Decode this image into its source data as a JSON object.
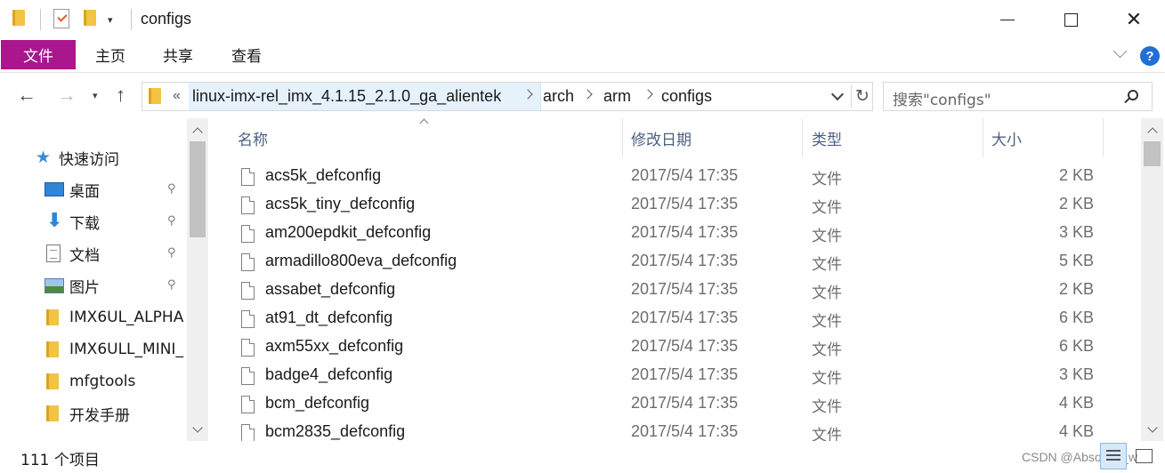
{
  "window": {
    "title": "configs",
    "minimize_icon": "minimize-icon",
    "maximize_icon": "maximize-icon",
    "close_glyph": "✕"
  },
  "quick_access_toolbar": {
    "dropdown_glyph": "▾"
  },
  "ribbon": {
    "tabs": [
      "文件",
      "主页",
      "共享",
      "查看"
    ],
    "file_tab_color": "#a9168d",
    "help_label": "?"
  },
  "navigation": {
    "back_glyph": "←",
    "forward_glyph": "→",
    "recent_glyph": "▾",
    "up_glyph": "↑"
  },
  "address": {
    "overflow": "«",
    "crumbs": [
      "linux-imx-rel_imx_4.1.15_2.1.0_ga_alientek",
      "arch",
      "arm",
      "configs"
    ],
    "refresh_glyph": "↻"
  },
  "search": {
    "placeholder": "搜索\"configs\""
  },
  "sidebar": {
    "items": [
      {
        "label": "快速访问",
        "icon": "star-icon"
      },
      {
        "label": "桌面",
        "icon": "desktop-icon",
        "pinned": true
      },
      {
        "label": "下载",
        "icon": "download-icon",
        "pinned": true
      },
      {
        "label": "文档",
        "icon": "document-icon",
        "pinned": true
      },
      {
        "label": "图片",
        "icon": "pictures-icon",
        "pinned": true
      },
      {
        "label": "IMX6UL_ALPHA",
        "icon": "folder-icon"
      },
      {
        "label": "IMX6ULL_MINI_",
        "icon": "folder-icon"
      },
      {
        "label": "mfgtools",
        "icon": "folder-icon"
      },
      {
        "label": "开发手册",
        "icon": "folder-icon"
      }
    ],
    "pin_glyph": "📌"
  },
  "file_list": {
    "columns": {
      "name": "名称",
      "date": "修改日期",
      "type": "类型",
      "size": "大小"
    },
    "rows": [
      {
        "name": "acs5k_defconfig",
        "date": "2017/5/4 17:35",
        "type": "文件",
        "size": "2 KB"
      },
      {
        "name": "acs5k_tiny_defconfig",
        "date": "2017/5/4 17:35",
        "type": "文件",
        "size": "2 KB"
      },
      {
        "name": "am200epdkit_defconfig",
        "date": "2017/5/4 17:35",
        "type": "文件",
        "size": "3 KB"
      },
      {
        "name": "armadillo800eva_defconfig",
        "date": "2017/5/4 17:35",
        "type": "文件",
        "size": "5 KB"
      },
      {
        "name": "assabet_defconfig",
        "date": "2017/5/4 17:35",
        "type": "文件",
        "size": "2 KB"
      },
      {
        "name": "at91_dt_defconfig",
        "date": "2017/5/4 17:35",
        "type": "文件",
        "size": "6 KB"
      },
      {
        "name": "axm55xx_defconfig",
        "date": "2017/5/4 17:35",
        "type": "文件",
        "size": "6 KB"
      },
      {
        "name": "badge4_defconfig",
        "date": "2017/5/4 17:35",
        "type": "文件",
        "size": "3 KB"
      },
      {
        "name": "bcm_defconfig",
        "date": "2017/5/4 17:35",
        "type": "文件",
        "size": "4 KB"
      },
      {
        "name": "bcm2835_defconfig",
        "date": "2017/5/4 17:35",
        "type": "文件",
        "size": "4 KB"
      }
    ]
  },
  "status": {
    "item_count": "111 个项目",
    "watermark": "CSDN @Absolute_w"
  }
}
